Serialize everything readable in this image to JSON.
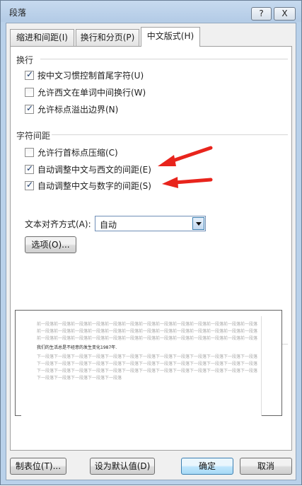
{
  "window": {
    "title": "段落",
    "help_label": "?",
    "close_label": "X"
  },
  "tabs": [
    {
      "label": "缩进和间距(I)",
      "active": false
    },
    {
      "label": "换行和分页(P)",
      "active": false
    },
    {
      "label": "中文版式(H)",
      "active": true
    }
  ],
  "line_break": {
    "heading": "换行",
    "options": [
      {
        "label": "按中文习惯控制首尾字符(U)",
        "checked": true
      },
      {
        "label": "允许西文在单词中间换行(W)",
        "checked": false
      },
      {
        "label": "允许标点溢出边界(N)",
        "checked": true
      }
    ]
  },
  "char_spacing": {
    "heading": "字符间距",
    "options": [
      {
        "label": "允许行首标点压缩(C)",
        "checked": false
      },
      {
        "label": "自动调整中文与西文的间距(E)",
        "checked": true
      },
      {
        "label": "自动调整中文与数字的间距(S)",
        "checked": true
      }
    ],
    "alignment_label": "文本对齐方式(A):",
    "alignment_value": "自动",
    "options_button": "选项(O)..."
  },
  "preview": {
    "heading": "预览",
    "lines_before": [
      "前一段落前一段落前一段落前一段落前一段落前一段落前一段落前一段落前一段落前一段落前一段落前一段落前一段落",
      "前一段落前一段落前一段落前一段落前一段落前一段落前一段落前一段落前一段落前一段落前一段落前一段落前一段落",
      "前一段落前一段落前一段落前一段落前一段落前一段落前一段落前一段落前一段落前一段落前一段落前一段落前一段落"
    ],
    "main_line": "我们的生活总是不经意的发生变化1987年.",
    "lines_after": [
      "下一段落下一段落下一段落下一段落下一段落下一段落下一段落下一段落下一段落下一段落下一段落下一段落下一段落",
      "下一段落下一段落下一段落下一段落下一段落下一段落下一段落下一段落下一段落下一段落下一段落下一段落下一段落",
      "下一段落下一段落下一段落下一段落下一段落下一段落下一段落下一段落下一段落下一段落下一段落下一段落下一段落",
      "下一段落下一段落下一段落下一段落下一段落"
    ]
  },
  "footer": {
    "tabs_button": "制表位(T)...",
    "default_button": "设为默认值(D)",
    "ok_button": "确定",
    "cancel_button": "取消"
  },
  "accent_colors": {
    "arrow": "#e8241c",
    "title_bar": "#b9d1ea",
    "default_button": "#bee6fd"
  }
}
